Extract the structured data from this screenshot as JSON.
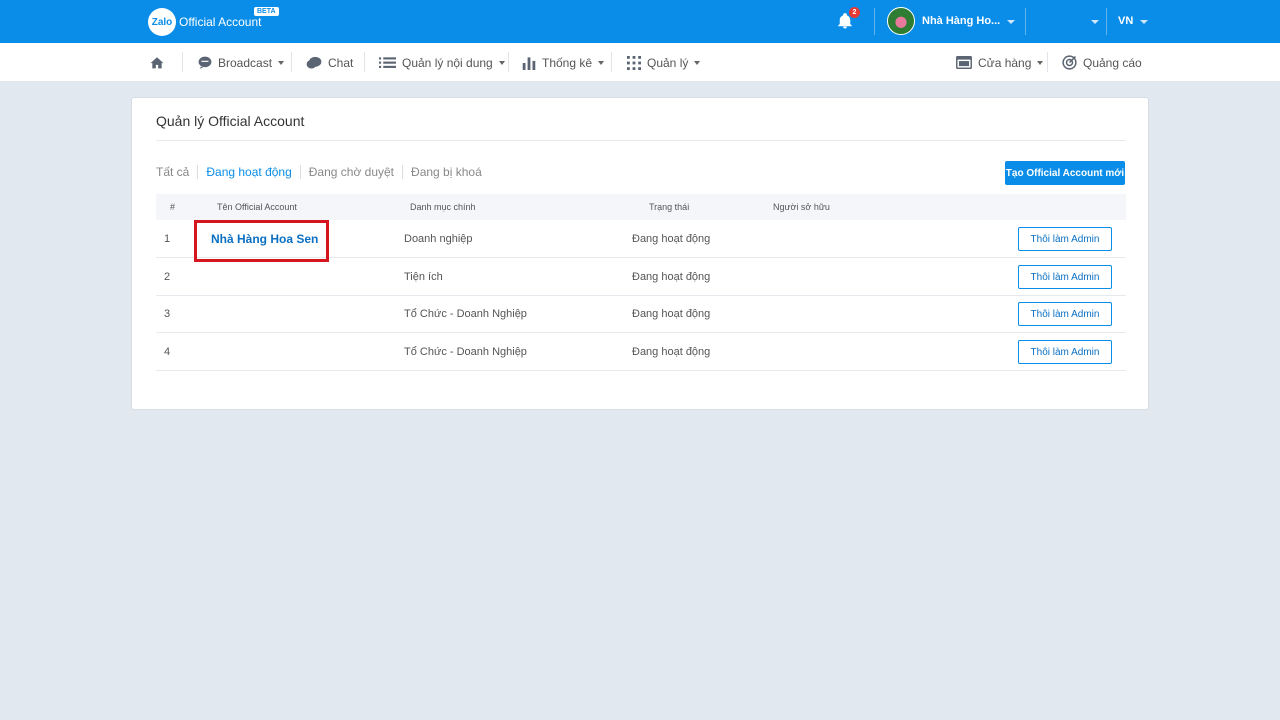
{
  "colors": {
    "brand": "#0a8de8",
    "highlight_box": "#d6161e",
    "badge": "#e53935"
  },
  "topbar": {
    "logo_mark": "Zalo",
    "logo_text": "Official Account",
    "beta_label": "BETA",
    "notification_count": "2",
    "account_name": "Nhà Hàng Ho...",
    "language": "VN",
    "icons": [
      "bell-icon",
      "avatar",
      "chevron-down-icon"
    ]
  },
  "nav": {
    "home_icon": "home-icon",
    "items": [
      {
        "label": "Broadcast",
        "icon": "broadcast-icon",
        "dropdown": true
      },
      {
        "label": "Chat",
        "icon": "chat-icon",
        "dropdown": false
      },
      {
        "label": "Quản lý nội dung",
        "icon": "list-icon",
        "dropdown": true
      },
      {
        "label": "Thống kê",
        "icon": "bar-chart-icon",
        "dropdown": true
      },
      {
        "label": "Quản lý",
        "icon": "grid-icon",
        "dropdown": true
      }
    ],
    "right_items": [
      {
        "label": "Cửa hàng",
        "icon": "store-icon",
        "dropdown": true
      },
      {
        "label": "Quảng cáo",
        "icon": "ads-icon",
        "dropdown": false
      }
    ]
  },
  "main": {
    "title": "Quản lý Official Account",
    "tabs": [
      {
        "label": "Tất cả",
        "active": false
      },
      {
        "label": "Đang hoạt động",
        "active": true
      },
      {
        "label": "Đang chờ duyệt",
        "active": false
      },
      {
        "label": "Đang bị khoá",
        "active": false
      }
    ],
    "create_button": "Tạo Official Account mới",
    "table": {
      "headers": [
        "#",
        "Tên Official Account",
        "Danh mục chính",
        "Trạng thái",
        "Người sở hữu"
      ],
      "rows": [
        {
          "index": "1",
          "name": "Nhà Hàng Hoa Sen",
          "category": "Doanh nghiệp",
          "status": "Đang hoạt động",
          "owner": "",
          "action": "Thôi làm Admin"
        },
        {
          "index": "2",
          "name": "",
          "category": "Tiện ích",
          "status": "Đang hoạt động",
          "owner": "",
          "action": "Thôi làm Admin"
        },
        {
          "index": "3",
          "name": "",
          "category": "Tổ Chức - Doanh Nghiệp",
          "status": "Đang hoạt động",
          "owner": "",
          "action": "Thôi làm Admin"
        },
        {
          "index": "4",
          "name": "",
          "category": "Tổ Chức - Doanh Nghiệp",
          "status": "Đang hoạt động",
          "owner": "",
          "action": "Thôi làm Admin"
        }
      ]
    }
  }
}
